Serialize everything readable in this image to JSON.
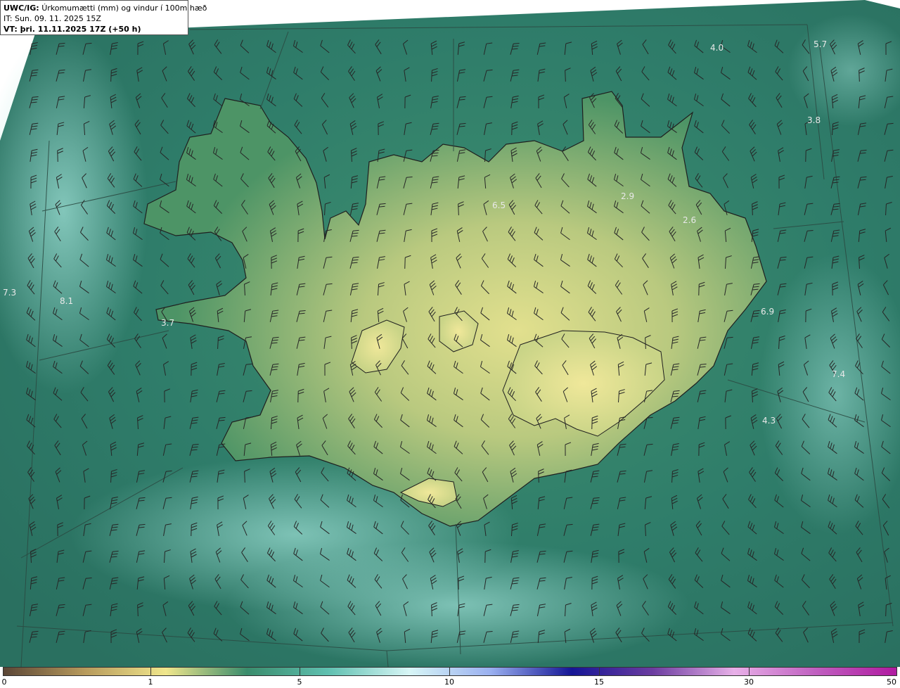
{
  "header": {
    "model_label": "UWC/IG:",
    "title": "Úrkomumætti (mm) og vindur í 100m hæð",
    "it_line": "IT: Sun. 09. 11. 2025 15Z",
    "vt_line": "VT: þri. 11.11.2025 17Z (+50 h)"
  },
  "colors": {
    "background_white": "#ffffff",
    "sea_dark": "#2f7d6a",
    "sea_light": "#8fd6cc",
    "land_low": "#3f8a62",
    "land_high": "#d9df8e",
    "coastline": "#1f1f1f",
    "grid": "#2b4a42"
  },
  "map_labels": [
    {
      "text": "4.0"
    },
    {
      "text": "5.7"
    },
    {
      "text": "3.8"
    },
    {
      "text": "2.9"
    },
    {
      "text": "6.5"
    },
    {
      "text": "2.6"
    },
    {
      "text": "7.3"
    },
    {
      "text": "8.1"
    },
    {
      "text": "3.7"
    },
    {
      "text": "6.9"
    },
    {
      "text": "7.4"
    },
    {
      "text": "4.3"
    }
  ],
  "colorbar": {
    "ticks": [
      "0",
      "1",
      "5",
      "10",
      "15",
      "30",
      "50"
    ],
    "stops": [
      "#5b4636",
      "#b79a5c",
      "#f0e68c",
      "#3a8c6c",
      "#5fc0b0",
      "#d8f6f6",
      "#9ab0f0",
      "#151595",
      "#6c3ca0",
      "#e8b0e8",
      "#c060c0",
      "#b01aa0"
    ]
  }
}
